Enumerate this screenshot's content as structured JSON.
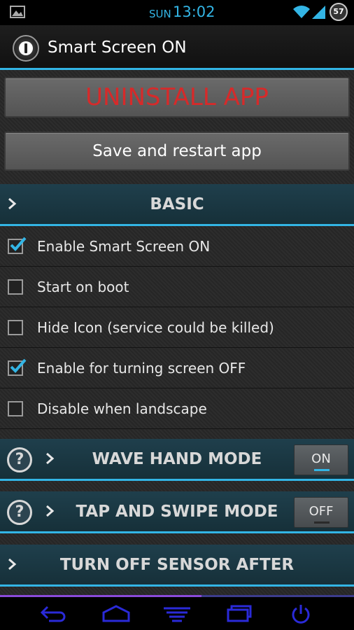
{
  "status": {
    "day": "SUN",
    "time": "13:02",
    "battery": "57"
  },
  "app": {
    "title": "Smart Screen ON"
  },
  "buttons": {
    "uninstall": "UNINSTALL APP",
    "save": "Save and restart app"
  },
  "sections": {
    "basic": "BASIC",
    "wave": {
      "label": "WAVE HAND MODE",
      "toggle": "ON"
    },
    "tap": {
      "label": "TAP AND SWIPE MODE",
      "toggle": "OFF"
    },
    "sensor": "TURN OFF SENSOR AFTER"
  },
  "help": "?",
  "settings": [
    {
      "label": "Enable Smart Screen ON",
      "checked": true
    },
    {
      "label": "Start on boot",
      "checked": false
    },
    {
      "label": "Hide Icon (service could be killed)",
      "checked": false
    },
    {
      "label": "Enable for turning screen OFF",
      "checked": true
    },
    {
      "label": "Disable when landscape",
      "checked": false
    }
  ],
  "colors": {
    "accent": "#33b5e5",
    "uninstall": "#d62a2a",
    "nav_icon": "#2a2ad8"
  },
  "icons": [
    "gallery-icon",
    "wifi-icon",
    "signal-icon",
    "power-icon",
    "back-icon",
    "home-icon",
    "menu-icon",
    "recent-apps-icon",
    "chevron-right-icon",
    "check-icon",
    "help-icon"
  ]
}
